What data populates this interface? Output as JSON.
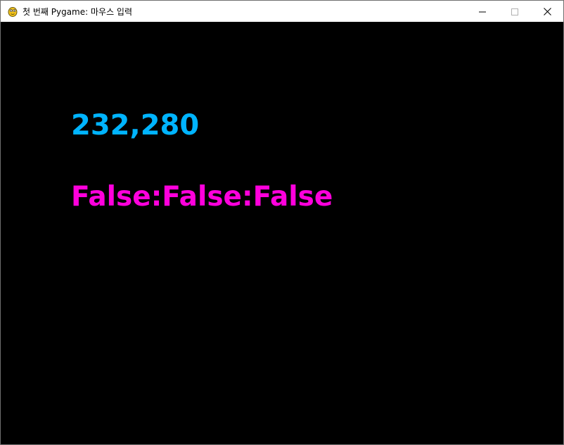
{
  "window": {
    "title": "첫 번째 Pygame: 마우스 입력",
    "icon": "pygame-snake-icon",
    "controls": [
      "minimize-icon",
      "maximize-icon",
      "close-icon"
    ]
  },
  "canvas": {
    "background": "#000000",
    "mouse_position": {
      "text": "232,280",
      "color": "#00b4ff"
    },
    "mouse_buttons": {
      "text": "False:False:False",
      "color": "#ff00dc"
    }
  }
}
